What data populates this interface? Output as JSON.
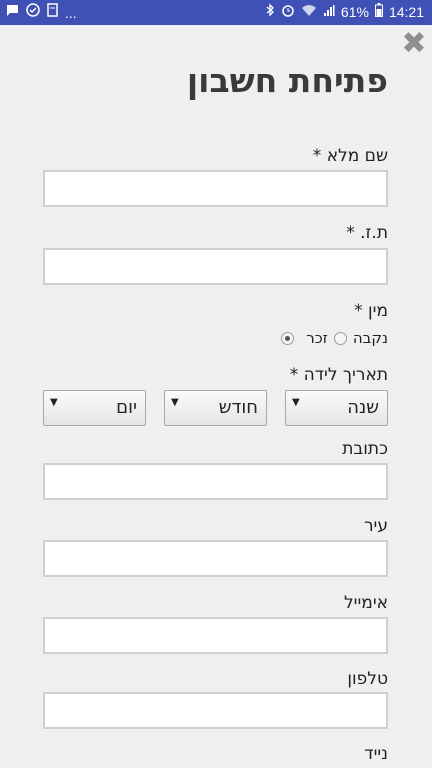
{
  "status_bar": {
    "left_icons": [
      "message-icon",
      "check-circle-icon",
      "sim-icon"
    ],
    "ellipsis": "...",
    "battery": "61%",
    "time": "14:21"
  },
  "form": {
    "title": "פתיחת חשבון",
    "fields": {
      "full_name": {
        "label": "שם מלא",
        "required": "*"
      },
      "id_number": {
        "label": "ת.ז.",
        "required": "*"
      },
      "gender": {
        "label": "מין",
        "required": "*"
      },
      "birthdate": {
        "label": "תאריך לידה",
        "required": "*"
      },
      "address": {
        "label": "כתובת"
      },
      "city": {
        "label": "עיר"
      },
      "email": {
        "label": "אימייל"
      },
      "phone": {
        "label": "טלפון"
      },
      "mobile": {
        "label": "נייד"
      }
    },
    "gender_options": {
      "male": "זכר",
      "female": "נקבה",
      "selected": "male"
    },
    "birthdate_selects": {
      "year": "שנה",
      "month": "חודש",
      "day": "יום"
    }
  }
}
